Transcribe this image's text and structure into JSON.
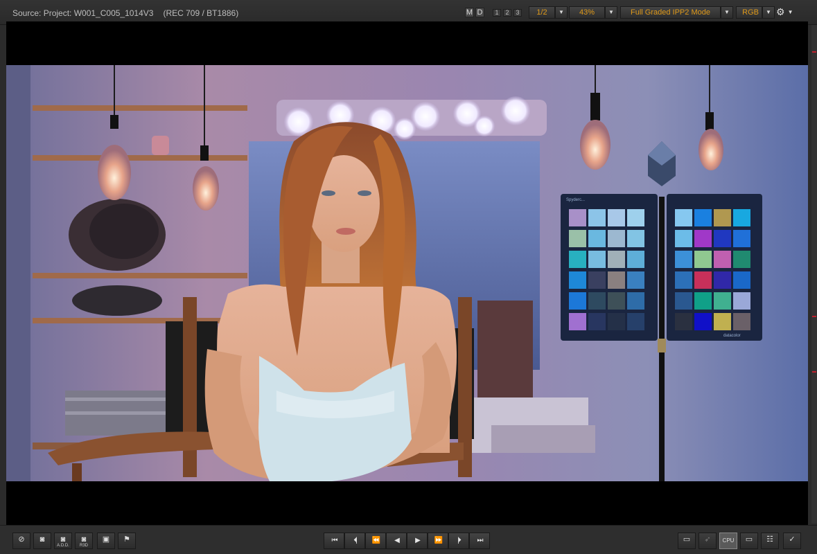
{
  "header": {
    "source_label": "Source: Project: W001_C005_1014V3",
    "colorspace": "(REC 709 / BT1886)",
    "mode_m": "M",
    "mode_d": "D",
    "layouts": [
      "1",
      "2",
      "3"
    ],
    "resolution": "1/2",
    "zoom": "43%",
    "grade_mode": "Full Graded IPP2 Mode",
    "channel": "RGB"
  },
  "chart": {
    "brand_left": "Spyderc...",
    "brand_right": "datacolor"
  },
  "accent_color": "#e09a1a",
  "toolbar_left": {
    "add_label": "A.D.D.",
    "r3d_label": "R3D"
  },
  "toolbar_right": {
    "cpu_label": "CPU"
  },
  "icons": [
    "no-overlay-icon",
    "camera-icon",
    "add-camera-icon",
    "r3d-camera-icon",
    "frame-icon",
    "flag-icon",
    "go-to-start-icon",
    "previous-frame-icon",
    "rewind-icon",
    "play-reverse-icon",
    "play-icon",
    "fast-forward-icon",
    "next-frame-icon",
    "go-to-end-icon",
    "monitor-icon",
    "rocket-icon",
    "cpu-icon",
    "aspect-icon",
    "filmstrip-icon",
    "settings-check-icon",
    "gear-icon"
  ]
}
